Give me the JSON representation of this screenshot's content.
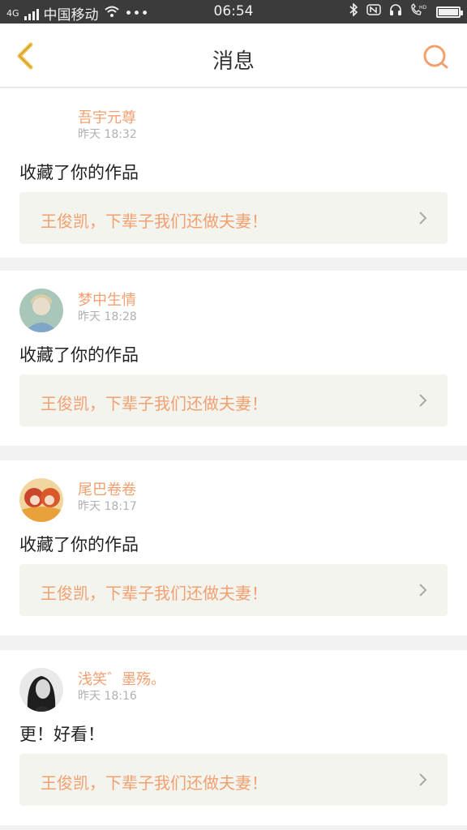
{
  "status_bar": {
    "network": "4G",
    "carrier": "中国移动",
    "time": "06:54",
    "battery_level": 1.0,
    "icons": [
      "signal-icon",
      "wifi-icon",
      "more-icon",
      "bluetooth-icon",
      "nfc-icon",
      "headset-icon",
      "hd-call-icon",
      "battery-icon"
    ]
  },
  "header": {
    "title": "消息",
    "back_icon": "chevron-left-icon",
    "search_icon": "search-icon",
    "accent_back": "#f2c24a",
    "accent_search": "#f2a070"
  },
  "messages": [
    {
      "username": "吾宇元尊",
      "time": "昨天 18:32",
      "action": "收藏了你的作品",
      "work_title": "王俊凯，下辈子我们还做夫妻！",
      "has_avatar": false
    },
    {
      "username": "梦中生情",
      "time": "昨天 18:28",
      "action": "收藏了你的作品",
      "work_title": "王俊凯，下辈子我们还做夫妻！",
      "has_avatar": true
    },
    {
      "username": "尾巴卷卷",
      "time": "昨天 18:17",
      "action": "收藏了你的作品",
      "work_title": "王俊凯，下辈子我们还做夫妻！",
      "has_avatar": true
    },
    {
      "username": "浅笑゛墨殇。",
      "time": "昨天 18:16",
      "action": "更！好看！",
      "work_title": "王俊凯，下辈子我们还做夫妻！",
      "has_avatar": true
    }
  ],
  "colors": {
    "accent_orange": "#f2a070",
    "card_bg": "#ffffff",
    "work_bg": "#f4f4ef",
    "separator": "#f2f2f2"
  }
}
